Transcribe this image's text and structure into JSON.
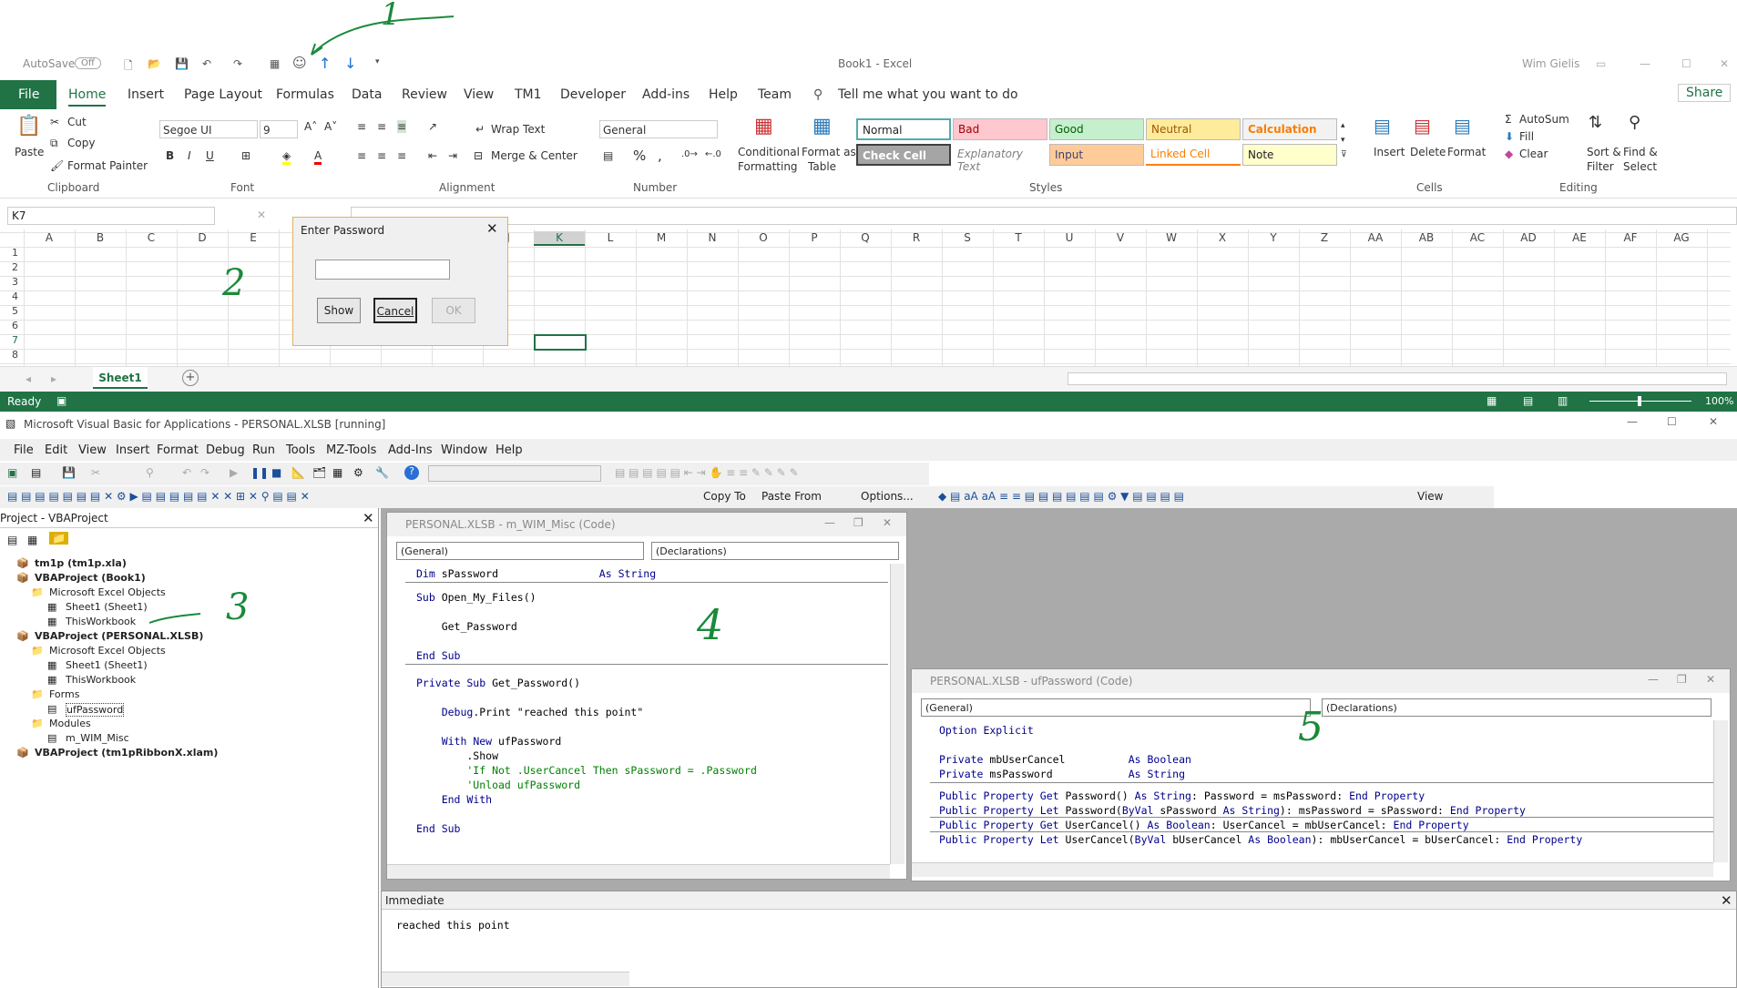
{
  "excel": {
    "qat": {
      "autosave_label": "AutoSave",
      "autosave_state": "Off",
      "title": "Book1 - Excel",
      "user": "Wim Gielis"
    },
    "tabs": [
      "File",
      "Home",
      "Insert",
      "Page Layout",
      "Formulas",
      "Data",
      "Review",
      "View",
      "TM1",
      "Developer",
      "Add-ins",
      "Help",
      "Team"
    ],
    "tellme": "Tell me what you want to do",
    "share": "Share",
    "ribbon": {
      "clipboard": {
        "paste": "Paste",
        "cut": "Cut",
        "copy": "Copy",
        "format_painter": "Format Painter",
        "group": "Clipboard"
      },
      "font": {
        "name": "Segoe UI",
        "size": "9",
        "group": "Font"
      },
      "alignment": {
        "wrap": "Wrap Text",
        "merge": "Merge & Center",
        "group": "Alignment"
      },
      "number": {
        "format": "General",
        "group": "Number"
      },
      "styles": {
        "cond": "Conditional",
        "cond2": "Formatting",
        "format_as": "Format as",
        "table": "Table",
        "group": "Styles",
        "cells": [
          "Normal",
          "Bad",
          "Good",
          "Neutral",
          "Calculation",
          "Check Cell",
          "Explanatory Text",
          "Input",
          "Linked Cell",
          "Note"
        ]
      },
      "cells": {
        "insert": "Insert",
        "delete": "Delete",
        "format": "Format",
        "group": "Cells"
      },
      "editing": {
        "autosum": "AutoSum",
        "fill": "Fill",
        "clear": "Clear",
        "sort": "Sort &",
        "sort2": "Filter",
        "find": "Find &",
        "find2": "Select",
        "group": "Editing"
      }
    },
    "namebox": "K7",
    "columns": [
      "A",
      "B",
      "C",
      "D",
      "E",
      "F",
      "G",
      "H",
      "I",
      "J",
      "K",
      "L",
      "M",
      "N",
      "O",
      "P",
      "Q",
      "R",
      "S",
      "T",
      "U",
      "V",
      "W",
      "X",
      "Y",
      "Z",
      "AA",
      "AB",
      "AC",
      "AD",
      "AE",
      "AF",
      "AG"
    ],
    "rows": [
      "1",
      "2",
      "3",
      "4",
      "5",
      "6",
      "7",
      "8"
    ],
    "sheet_tab": "Sheet1",
    "status": {
      "ready": "Ready",
      "zoom": "100%"
    }
  },
  "dialog": {
    "title": "Enter Password",
    "show": "Show",
    "cancel": "Cancel",
    "ok": "OK"
  },
  "vbe": {
    "title": "Microsoft Visual Basic for Applications - PERSONAL.XLSB [running]",
    "menu": [
      "File",
      "Edit",
      "View",
      "Insert",
      "Format",
      "Debug",
      "Run",
      "Tools",
      "MZ-Tools",
      "Add-Ins",
      "Window",
      "Help"
    ],
    "tb_copyto": "Copy To",
    "tb_pastefrom": "Paste From",
    "tb_options": "Options...",
    "tb_view": "View",
    "project_title": "Project - VBAProject",
    "tree": [
      "tm1p (tm1p.xla)",
      "VBAProject (Book1)",
      "Microsoft Excel Objects",
      "Sheet1 (Sheet1)",
      "ThisWorkbook",
      "VBAProject (PERSONAL.XLSB)",
      "Microsoft Excel Objects",
      "Sheet1 (Sheet1)",
      "ThisWorkbook",
      "Forms",
      "ufPassword",
      "Modules",
      "m_WIM_Misc",
      "VBAProject (tm1pRibbonX.xlam)"
    ],
    "code1": {
      "title": "PERSONAL.XLSB - m_WIM_Misc (Code)",
      "combo1": "(General)",
      "combo2": "(Declarations)"
    },
    "code2": {
      "title": "PERSONAL.XLSB - ufPassword (Code)",
      "combo1": "(General)",
      "combo2": "(Declarations)"
    },
    "immediate_title": "Immediate",
    "immediate_text": "reached this point"
  },
  "annotations": [
    "1",
    "2",
    "3",
    "4",
    "5"
  ]
}
